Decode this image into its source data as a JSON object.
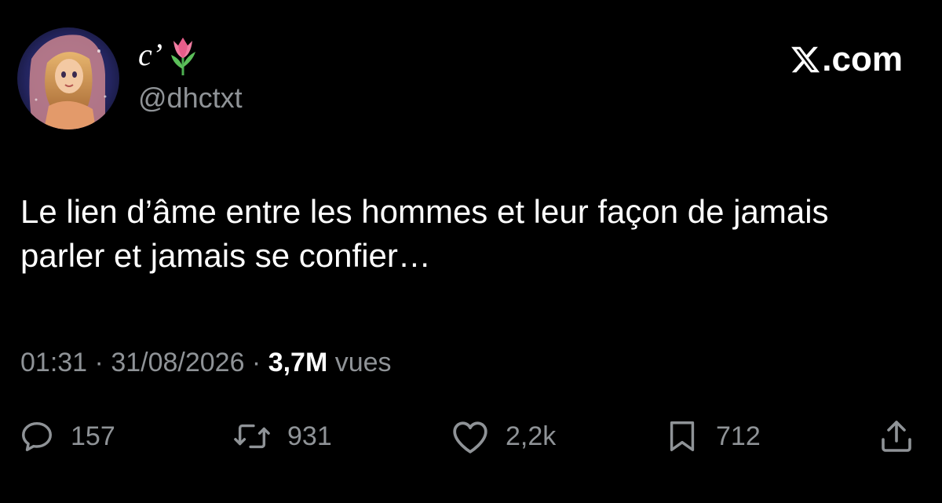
{
  "author": {
    "display_name": "c’",
    "name_emoji": "tulip-emoji",
    "handle": "@dhctxt",
    "avatar": "avatar-image"
  },
  "brand": {
    "label": ".com",
    "icon": "x-logo-icon"
  },
  "tweet": {
    "text": "Le lien d’âme entre les hommes et leur façon de jamais parler et jamais se confier…"
  },
  "meta": {
    "time": "01:31",
    "separator1": " · ",
    "date": "31/08/2026",
    "separator2": " · ",
    "views_count": "3,7M",
    "views_label": " vues"
  },
  "actions": {
    "reply": {
      "icon": "reply-icon",
      "count": "157"
    },
    "repost": {
      "icon": "repost-icon",
      "count": "931"
    },
    "like": {
      "icon": "heart-icon",
      "count": "2,2k"
    },
    "bookmark": {
      "icon": "bookmark-icon",
      "count": "712"
    },
    "share": {
      "icon": "share-icon"
    }
  },
  "colors": {
    "background": "#000000",
    "primary_text": "#ffffff",
    "secondary_text": "#8f9397"
  }
}
